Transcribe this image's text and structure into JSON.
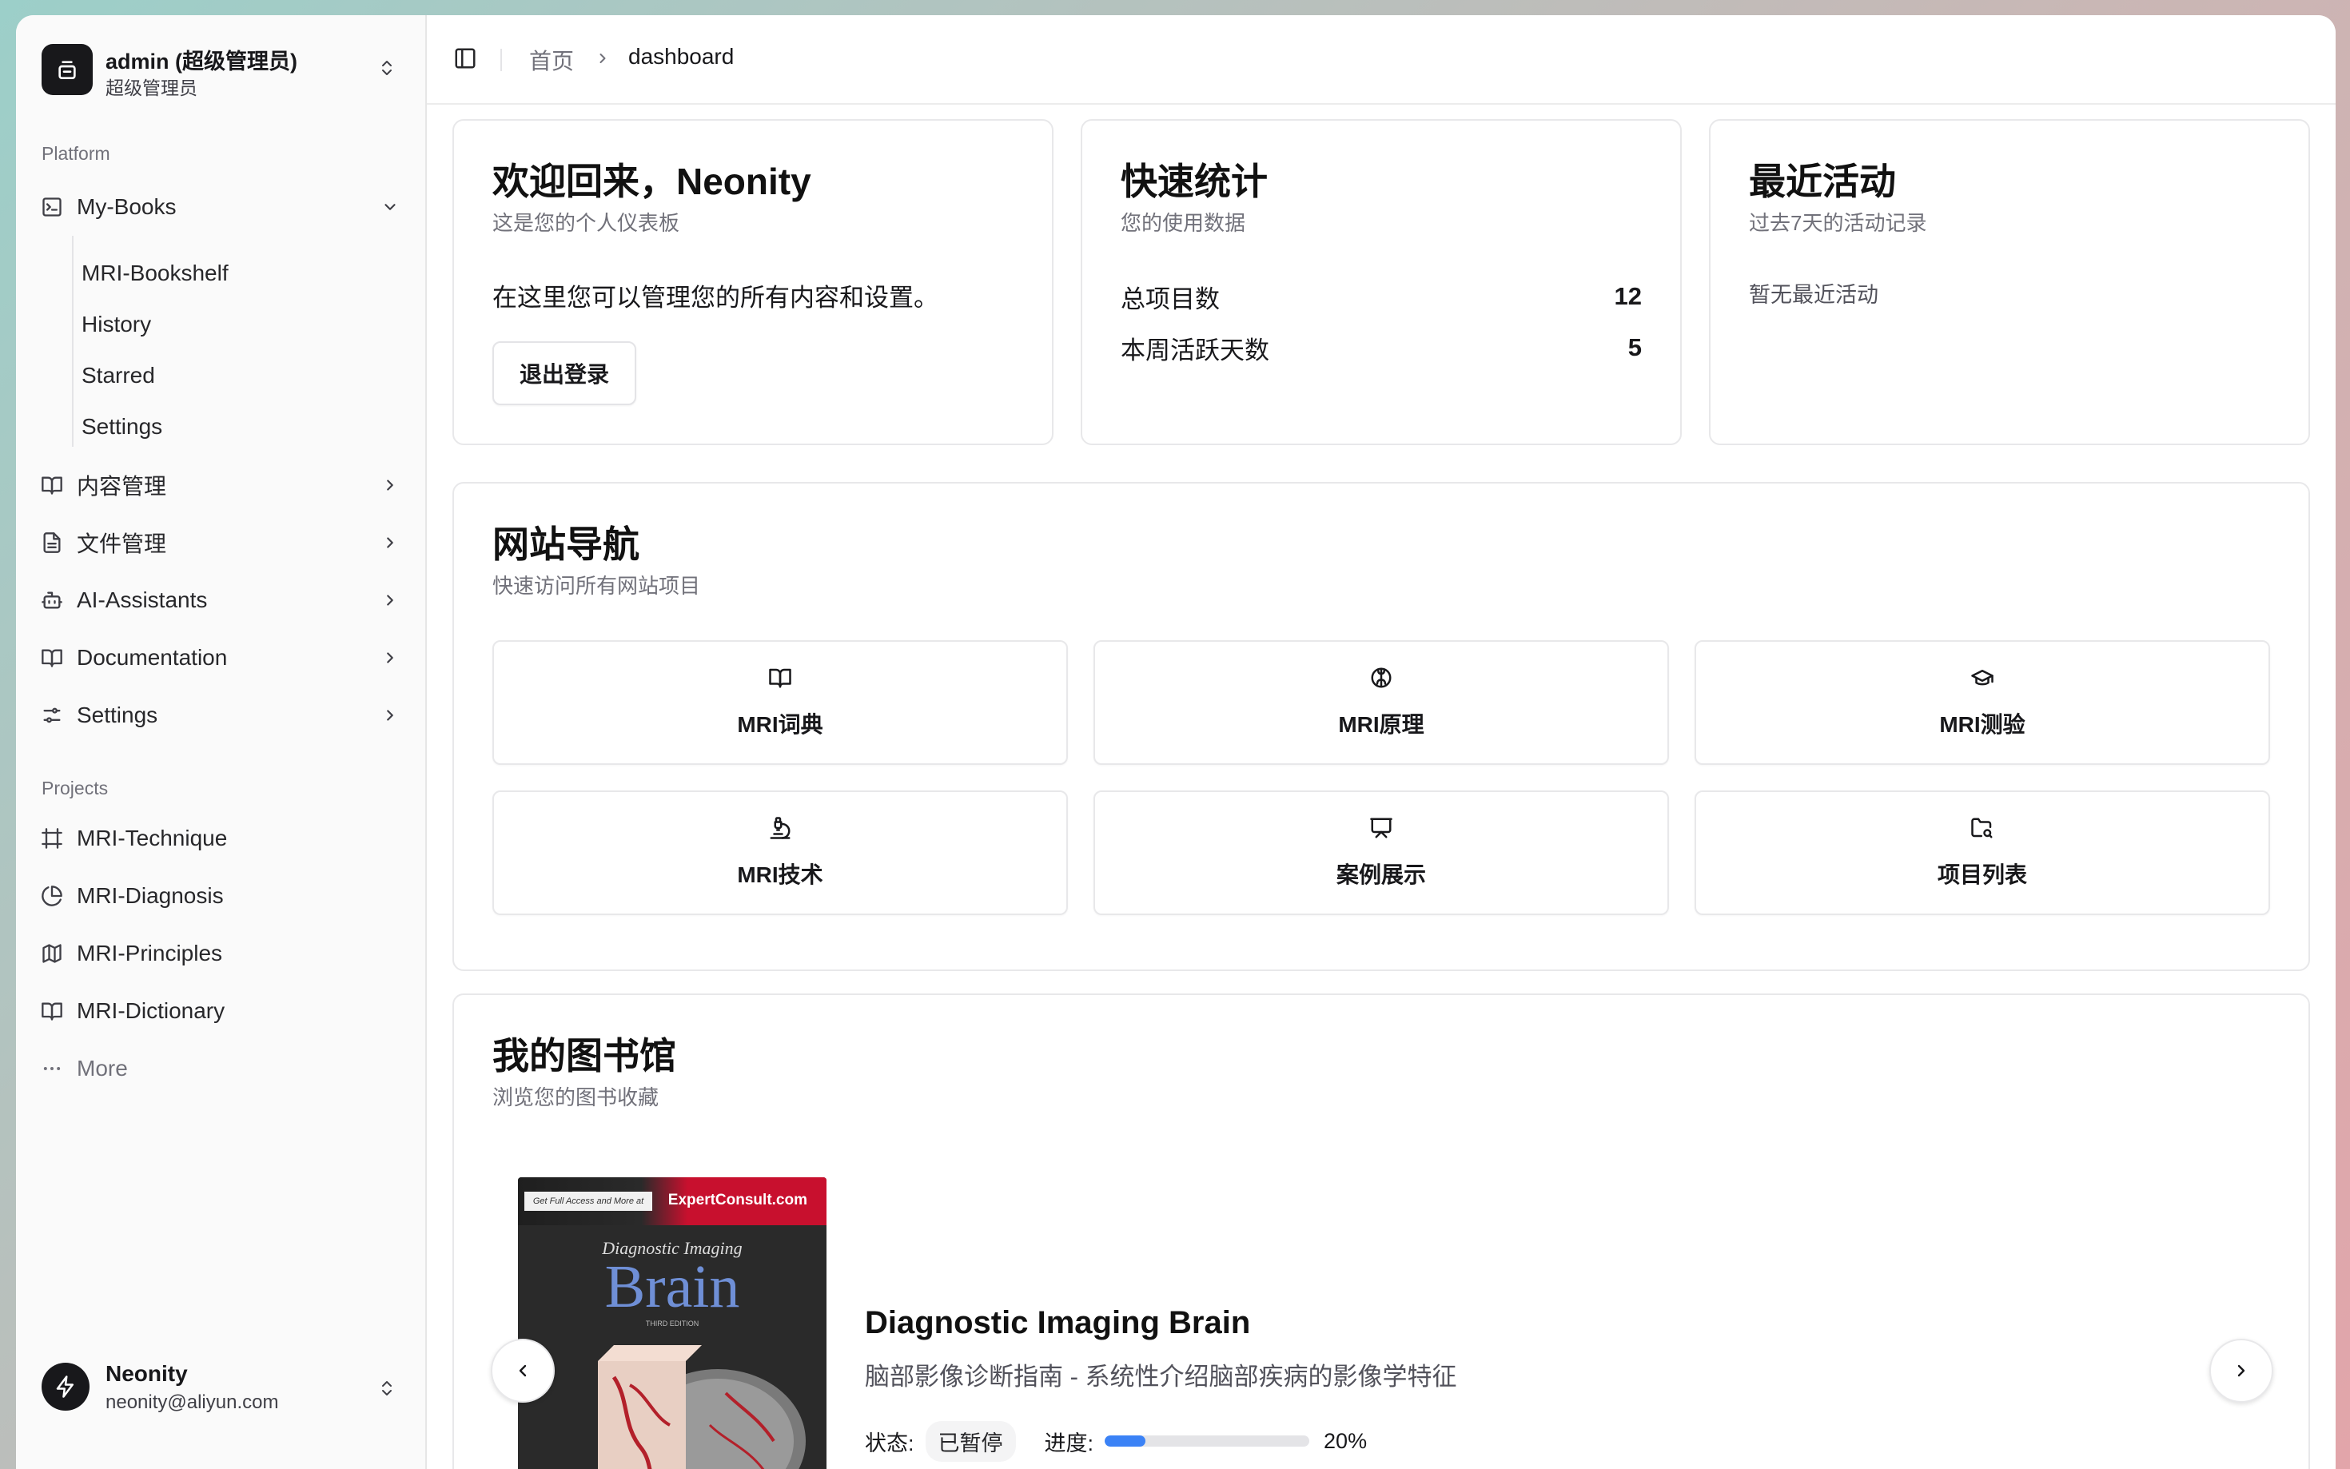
{
  "team": {
    "name": "admin (超级管理员)",
    "role": "超级管理员"
  },
  "sidebar": {
    "platform_label": "Platform",
    "platform_items": [
      {
        "label": "My-Books",
        "icon": "square-terminal-icon",
        "expanded": true
      },
      {
        "label": "内容管理",
        "icon": "book-open-icon"
      },
      {
        "label": "文件管理",
        "icon": "file-text-icon"
      },
      {
        "label": "AI-Assistants",
        "icon": "bot-icon"
      },
      {
        "label": "Documentation",
        "icon": "book-open-icon"
      },
      {
        "label": "Settings",
        "icon": "settings-sliders-icon"
      }
    ],
    "sub_items": [
      "MRI-Bookshelf",
      "History",
      "Starred",
      "Settings"
    ],
    "projects_label": "Projects",
    "projects": [
      {
        "label": "MRI-Technique",
        "icon": "frame-icon"
      },
      {
        "label": "MRI-Diagnosis",
        "icon": "pie-chart-icon"
      },
      {
        "label": "MRI-Principles",
        "icon": "map-icon"
      },
      {
        "label": "MRI-Dictionary",
        "icon": "book-open-icon"
      }
    ],
    "more_label": "More"
  },
  "user": {
    "name": "Neonity",
    "email": "neonity@aliyun.com"
  },
  "breadcrumb": {
    "home": "首页",
    "current": "dashboard"
  },
  "welcome": {
    "title": "欢迎回来，Neonity",
    "subtitle": "这是您的个人仪表板",
    "body": "在这里您可以管理您的所有内容和设置。",
    "logout_label": "退出登录"
  },
  "stats": {
    "title": "快速统计",
    "subtitle": "您的使用数据",
    "rows": [
      {
        "label": "总项目数",
        "value": "12"
      },
      {
        "label": "本周活跃天数",
        "value": "5"
      }
    ]
  },
  "activity": {
    "title": "最近活动",
    "subtitle": "过去7天的活动记录",
    "empty": "暂无最近活动"
  },
  "site_nav": {
    "title": "网站导航",
    "subtitle": "快速访问所有网站项目",
    "tiles": [
      {
        "label": "MRI词典",
        "icon": "book-open-icon"
      },
      {
        "label": "MRI原理",
        "icon": "brain-icon"
      },
      {
        "label": "MRI测验",
        "icon": "graduation-cap-icon"
      },
      {
        "label": "MRI技术",
        "icon": "microscope-icon"
      },
      {
        "label": "案例展示",
        "icon": "presentation-icon"
      },
      {
        "label": "项目列表",
        "icon": "folder-search-icon"
      }
    ]
  },
  "library": {
    "title": "我的图书馆",
    "subtitle": "浏览您的图书收藏",
    "book": {
      "title": "Diagnostic Imaging Brain",
      "description": "脑部影像诊断指南 - 系统性介绍脑部疾病的影像学特征",
      "status_label": "状态:",
      "status": "已暂停",
      "progress_label": "进度:",
      "progress": 0.2,
      "progress_text": "20%",
      "cover": {
        "small_text": "Get Full Access and More at",
        "brand": "ExpertConsult.com",
        "series": "Diagnostic Imaging",
        "subject": "Brain",
        "edition": "THIRD EDITION"
      }
    }
  },
  "colors": {
    "accent": "#3b82f6",
    "dark": "#18181b",
    "muted": "#71717a"
  }
}
